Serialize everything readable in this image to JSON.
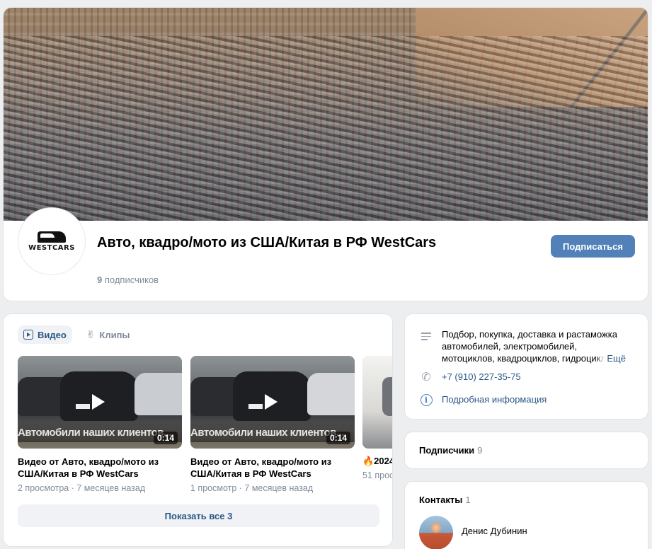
{
  "group": {
    "avatar_text": "WESTCARS",
    "title": "Авто, квадро/мото из США/Китая в РФ WestCars",
    "subscribers_count": "9",
    "subscribers_label": "подписчиков",
    "subscribe_label": "Подписаться"
  },
  "videos": {
    "tabs": [
      {
        "label": "Видео",
        "active": true
      },
      {
        "label": "Клипы",
        "active": false
      }
    ],
    "items": [
      {
        "overlay": "Автомобили наших клиентов...",
        "duration": "0:14",
        "title": "Видео от Авто, квадро/мото из США/Китая в РФ WestCars",
        "views": "2 просмотра",
        "age": "7 месяцев назад"
      },
      {
        "overlay": "Автомобили наших клиентов...",
        "duration": "0:14",
        "title": "Видео от Авто, квадро/мото из США/Китая в РФ WestCars",
        "views": "1 просмотр",
        "age": "7 месяцев назад"
      },
      {
        "title": "🔥2024",
        "meta": "51 прос"
      }
    ],
    "show_all_label": "Показать все 3"
  },
  "info": {
    "description": "Подбор, покупка, доставка и растаможка автомобилей, электромобилей, мотоциклов, квадроциклов, гидроциклов",
    "more_label": "Ещё",
    "phone": "+7 (910) 227-35-75",
    "details_label": "Подробная информация"
  },
  "subscribers_block": {
    "label": "Подписчики",
    "count": "9"
  },
  "contacts_block": {
    "label": "Контакты",
    "count": "1",
    "people": [
      {
        "name": "Денис Дубинин"
      }
    ]
  },
  "colors": {
    "accent": "#5181b8",
    "link": "#2a5885",
    "muted": "#818c99",
    "page_bg": "#edeef0"
  }
}
